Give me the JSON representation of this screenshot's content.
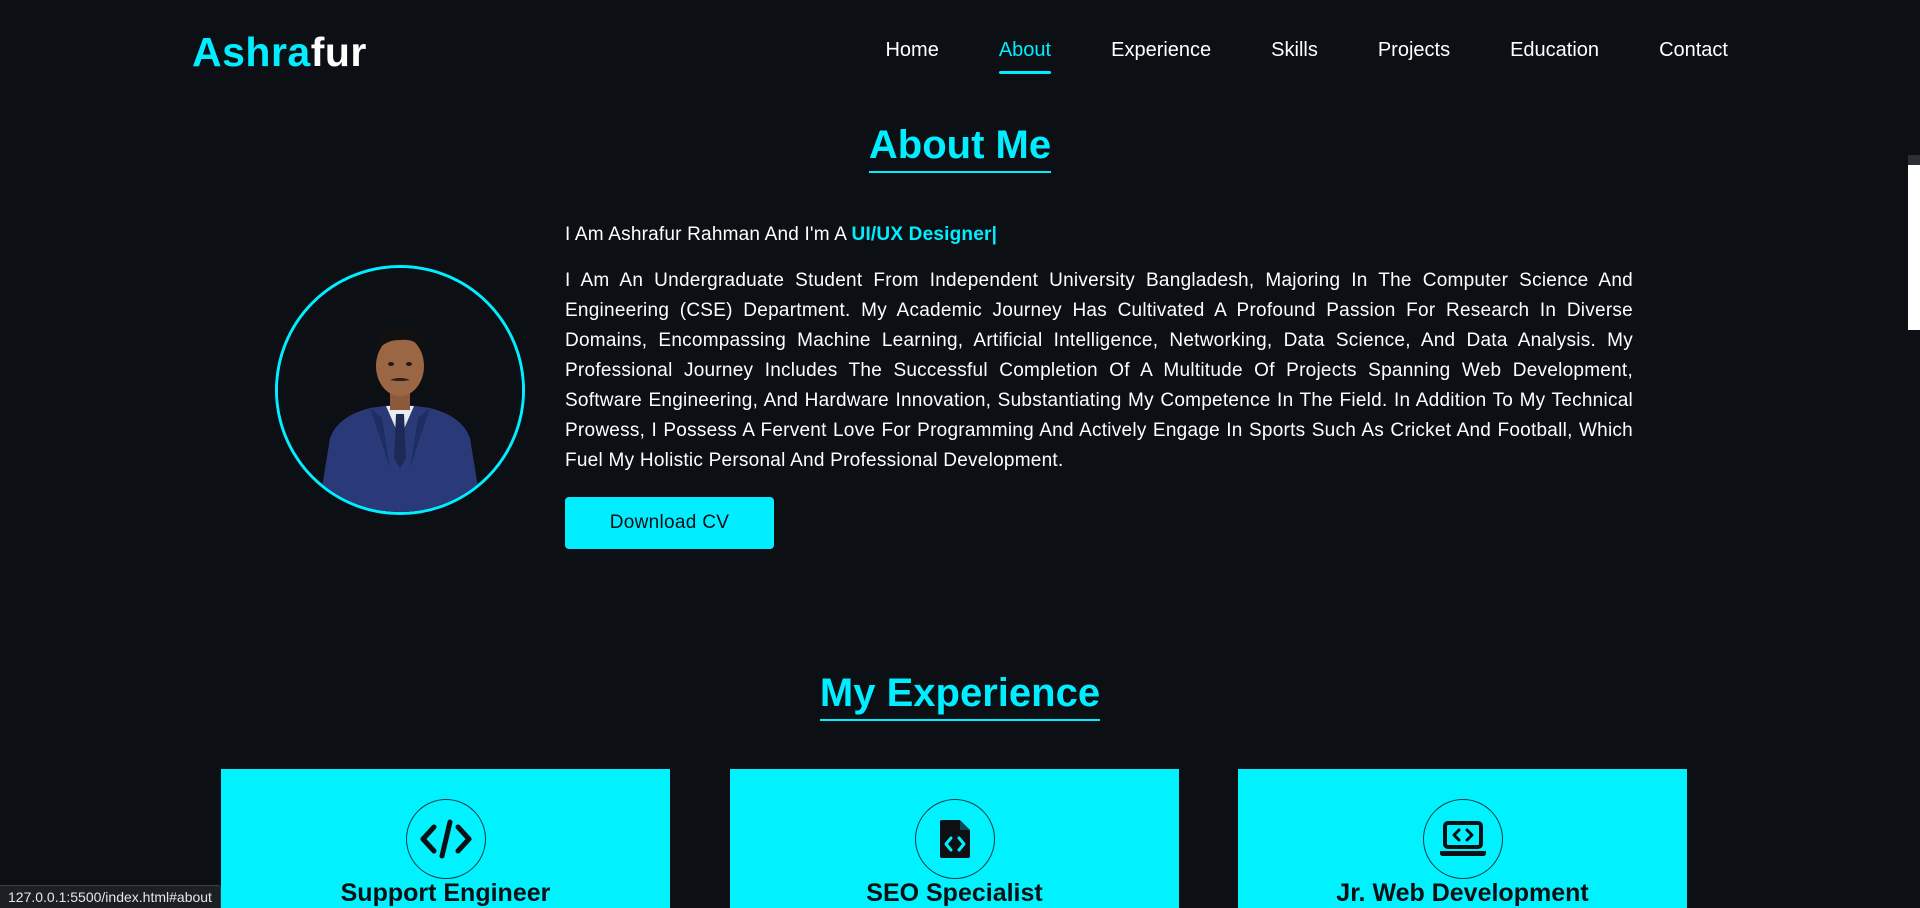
{
  "header": {
    "logo_accent": "Ashra",
    "logo_rest": "fur",
    "nav": [
      {
        "label": "Home",
        "active": false
      },
      {
        "label": "About",
        "active": true
      },
      {
        "label": "Experience",
        "active": false
      },
      {
        "label": "Skills",
        "active": false
      },
      {
        "label": "Projects",
        "active": false
      },
      {
        "label": "Education",
        "active": false
      },
      {
        "label": "Contact",
        "active": false
      }
    ]
  },
  "about": {
    "title": "About Me",
    "intro_prefix": "I Am Ashrafur Rahman And I'm A ",
    "intro_role": "UI/UX Designer|",
    "bio": "I Am An Undergraduate Student From Independent University Bangladesh, Majoring In The Computer Science And Engineering (CSE) Department. My Academic Journey Has Cultivated A Profound Passion For Research In Diverse Domains, Encompassing Machine Learning, Artificial Intelligence, Networking, Data Science, And Data Analysis. My Professional Journey Includes The Successful Completion Of A Multitude Of Projects Spanning Web Development, Software Engineering, And Hardware Innovation, Substantiating My Competence In The Field. In Addition To My Technical Prowess, I Possess A Fervent Love For Programming And Actively Engage In Sports Such As Cricket And Football, Which Fuel My Holistic Personal And Professional Development.",
    "cv_button": "Download CV"
  },
  "experience": {
    "title": "My Experience",
    "cards": [
      {
        "title": "Support Engineer",
        "icon": "code-icon"
      },
      {
        "title": "SEO Specialist",
        "icon": "file-code-icon"
      },
      {
        "title": "Jr. Web Development",
        "icon": "laptop-code-icon"
      }
    ]
  },
  "status_bar": {
    "url": "127.0.0.1:5500/index.html#about"
  },
  "colors": {
    "accent": "#00eeff",
    "background": "#0c0f13",
    "card": "#00f2ff"
  }
}
